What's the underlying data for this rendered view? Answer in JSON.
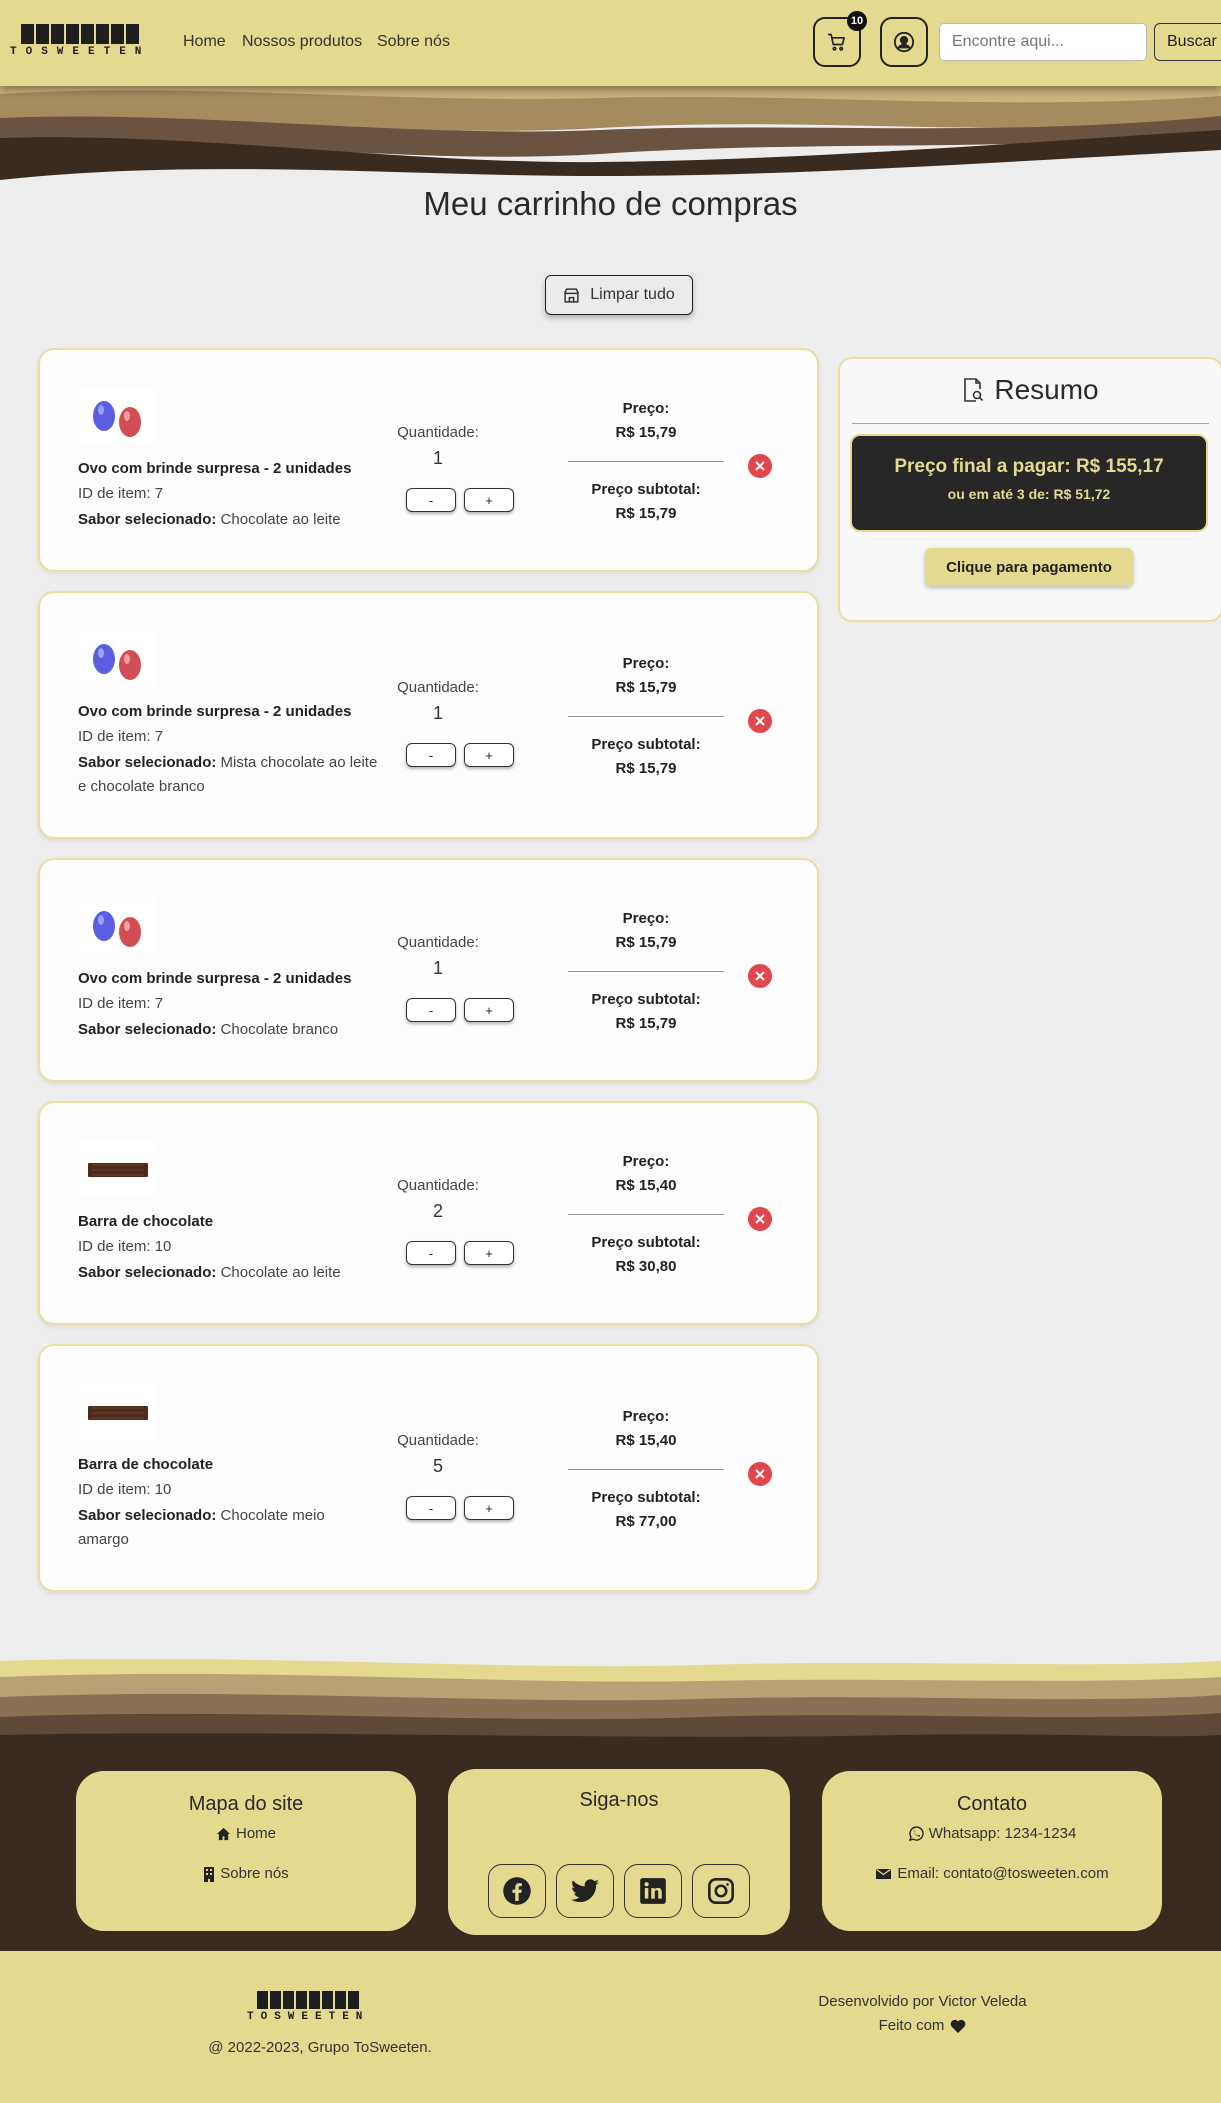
{
  "brand": {
    "logo_text": "TOSWEETEN"
  },
  "nav": {
    "links": [
      "Home",
      "Nossos produtos",
      "Sobre nós"
    ],
    "cart_count": "10",
    "search_placeholder": "Encontre aqui...",
    "search_button": "Buscar"
  },
  "page": {
    "title": "Meu carrinho de compras",
    "clear_button": "Limpar tudo"
  },
  "labels": {
    "quantity": "Quantidade:",
    "price": "Preço:",
    "subtotal": "Preço subtotal:",
    "minus": "-",
    "plus": "+",
    "flavor_prefix": "Sabor selecionado:"
  },
  "cart_items": [
    {
      "name": "Ovo com brinde surpresa - 2 unidades",
      "id_text": "ID de item: 7",
      "flavor": "Chocolate ao leite",
      "quantity": "1",
      "price": "R$ 15,79",
      "subtotal": "R$ 15,79",
      "image": "eggs"
    },
    {
      "name": "Ovo com brinde surpresa - 2 unidades",
      "id_text": "ID de item: 7",
      "flavor": "Mista chocolate ao leite e chocolate branco",
      "quantity": "1",
      "price": "R$ 15,79",
      "subtotal": "R$ 15,79",
      "image": "eggs"
    },
    {
      "name": "Ovo com brinde surpresa - 2 unidades",
      "id_text": "ID de item: 7",
      "flavor": "Chocolate branco",
      "quantity": "1",
      "price": "R$ 15,79",
      "subtotal": "R$ 15,79",
      "image": "eggs"
    },
    {
      "name": "Barra de chocolate",
      "id_text": "ID de item: 10",
      "flavor": "Chocolate ao leite",
      "quantity": "2",
      "price": "R$ 15,40",
      "subtotal": "R$ 30,80",
      "image": "bar"
    },
    {
      "name": "Barra de chocolate",
      "id_text": "ID de item: 10",
      "flavor": "Chocolate meio amargo",
      "quantity": "5",
      "price": "R$ 15,40",
      "subtotal": "R$ 77,00",
      "image": "bar"
    }
  ],
  "summary": {
    "title": "Resumo",
    "final_price": "Preço final a pagar: R$ 155,17",
    "installments": "ou em até 3 de: R$ 51,72",
    "pay_button": "Clique para pagamento"
  },
  "footer": {
    "sitemap": {
      "title": "Mapa do site",
      "home": "Home",
      "about": "Sobre nós"
    },
    "social": {
      "title": "Siga-nos",
      "networks": [
        "facebook-icon",
        "twitter-icon",
        "linkedin-icon",
        "instagram-icon"
      ]
    },
    "contact": {
      "title": "Contato",
      "whatsapp": "Whatsapp: 1234-1234",
      "email": "Email: contato@tosweeten.com"
    },
    "copyright": "@ 2022-2023, Grupo ToSweeten.",
    "developer": "Desenvolvido por Victor Veleda",
    "made_with": "Feito com"
  },
  "colors": {
    "brand_yellow": "#e3d98f",
    "dark_brown": "#3a2b21",
    "remove_red": "#e0474c"
  }
}
